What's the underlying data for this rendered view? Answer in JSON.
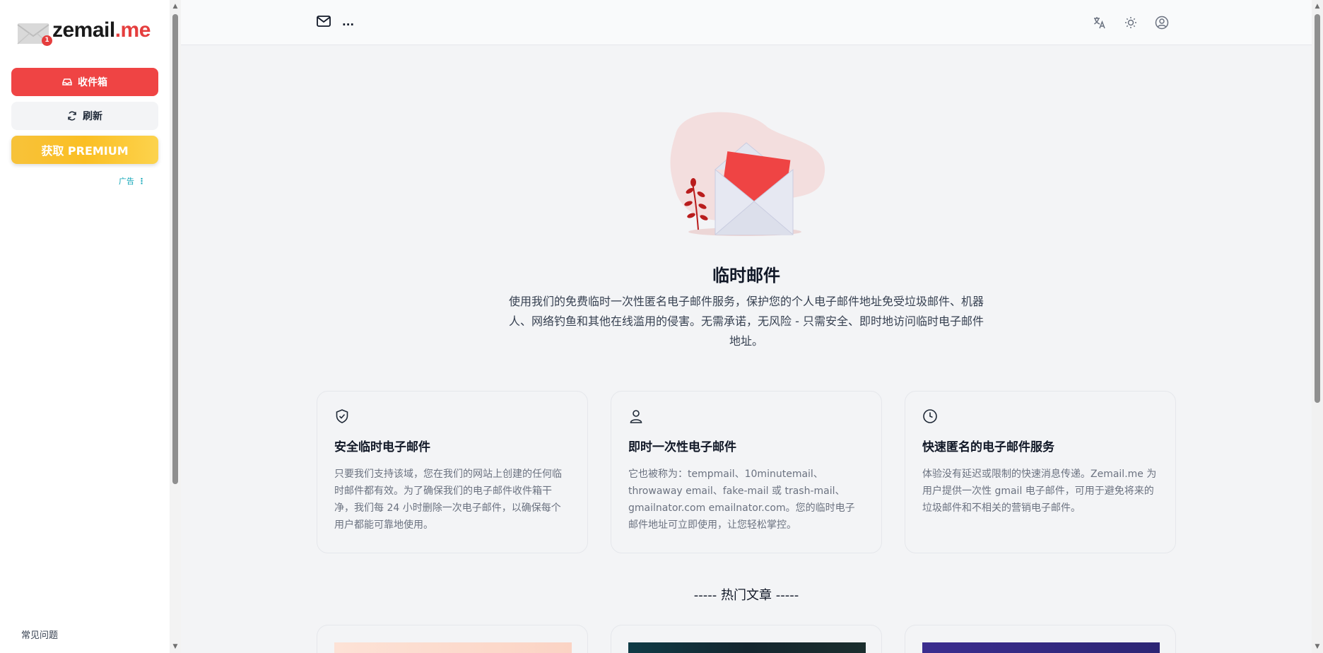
{
  "sidebar": {
    "logo": {
      "brand_a": "zemail",
      "brand_b": ".me",
      "badge": "1"
    },
    "inbox_label": "收件箱",
    "refresh_label": "刷新",
    "premium_label": "获取 PREMIUM",
    "ad_label": "广告",
    "faq_label": "常见问题"
  },
  "header": {
    "address": "...",
    "icons": [
      "translate-icon",
      "sun-icon",
      "user-circle-icon"
    ]
  },
  "hero": {
    "title": "临时邮件",
    "description": "使用我们的免费临时一次性匿名电子邮件服务，保护您的个人电子邮件地址免受垃圾邮件、机器人、网络钓鱼和其他在线滥用的侵害。无需承诺，无风险 - 只需安全、即时地访问临时电子邮件地址。"
  },
  "features": [
    {
      "icon": "shield-check-icon",
      "title": "安全临时电子邮件",
      "text": "只要我们支持该域，您在我们的网站上创建的任何临时邮件都有效。为了确保我们的电子邮件收件箱干净，我们每 24 小时删除一次电子邮件，以确保每个用户都能可靠地使用。"
    },
    {
      "icon": "user-icon",
      "title": "即时一次性电子邮件",
      "text": "它也被称为：tempmail、10minutemail、throwaway email、fake-mail 或 trash-mail、gmailnator.com emailnator.com。您的临时电子邮件地址可立即使用，让您轻松掌控。"
    },
    {
      "icon": "clock-icon",
      "title": "快速匿名的电子邮件服务",
      "text": "体验没有延迟或限制的快速消息传递。Zemail.me 为用户提供一次性 gmail 电子邮件，可用于避免将来的垃圾邮件和不相关的营销电子邮件。"
    }
  ],
  "articles": {
    "section_title": "----- 热门文章 -----"
  },
  "colors": {
    "accent": "#ef4444",
    "premium": "#fbbf24",
    "ad": "#0ea5b7"
  }
}
